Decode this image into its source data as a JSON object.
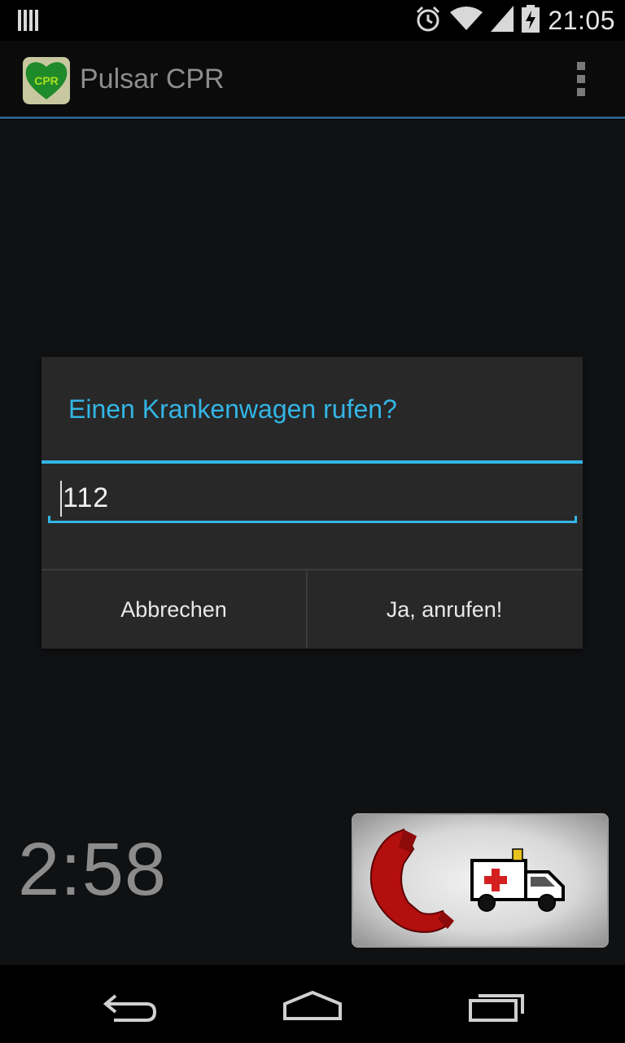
{
  "status_bar": {
    "time": "21:05",
    "icons": [
      "signal-bars-icon",
      "alarm-icon",
      "wifi-icon",
      "cell-signal-icon",
      "battery-charging-icon"
    ]
  },
  "action_bar": {
    "app_title": "Pulsar CPR",
    "app_icon_text": "CPR",
    "overflow_icon": "overflow-menu-icon"
  },
  "dialog": {
    "title": "Einen Krankenwagen rufen?",
    "input_value": "112",
    "cancel_label": "Abbrechen",
    "confirm_label": "Ja, anrufen!"
  },
  "main": {
    "timer": "2:58",
    "call_panel_icons": [
      "phone-handset-icon",
      "ambulance-icon"
    ]
  },
  "colors": {
    "accent": "#33b5e5",
    "phone_red": "#b30f0f"
  },
  "nav_bar": {
    "icons": [
      "back-icon",
      "home-icon",
      "recents-icon"
    ]
  }
}
